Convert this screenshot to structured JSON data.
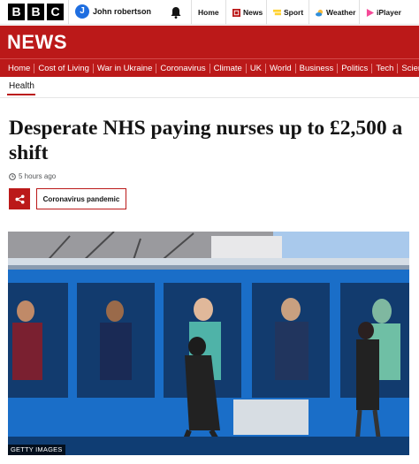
{
  "topbar": {
    "logo_letters": [
      "B",
      "B",
      "C"
    ],
    "user_initial": "J",
    "user_name": "John robertson",
    "nav": [
      {
        "label": "Home",
        "icon": "none"
      },
      {
        "label": "News",
        "icon": "news-icon"
      },
      {
        "label": "Sport",
        "icon": "sport-icon"
      },
      {
        "label": "Weather",
        "icon": "weather-icon"
      },
      {
        "label": "iPlayer",
        "icon": "iplayer-icon"
      }
    ]
  },
  "news_banner": {
    "title": "NEWS",
    "color": "#bb1919"
  },
  "sections": [
    "Home",
    "Cost of Living",
    "War in Ukraine",
    "Coronavirus",
    "Climate",
    "UK",
    "World",
    "Business",
    "Politics",
    "Tech",
    "Science"
  ],
  "article": {
    "section": "Health",
    "headline": "Desperate NHS paying nurses up to £2,500 a shift",
    "timestamp": "5 hours ago",
    "topic": "Coronavirus pandemic",
    "image_credit": "GETTY IMAGES"
  },
  "colors": {
    "accent": "#bb1919",
    "user_avatar": "#1f6ee0"
  }
}
